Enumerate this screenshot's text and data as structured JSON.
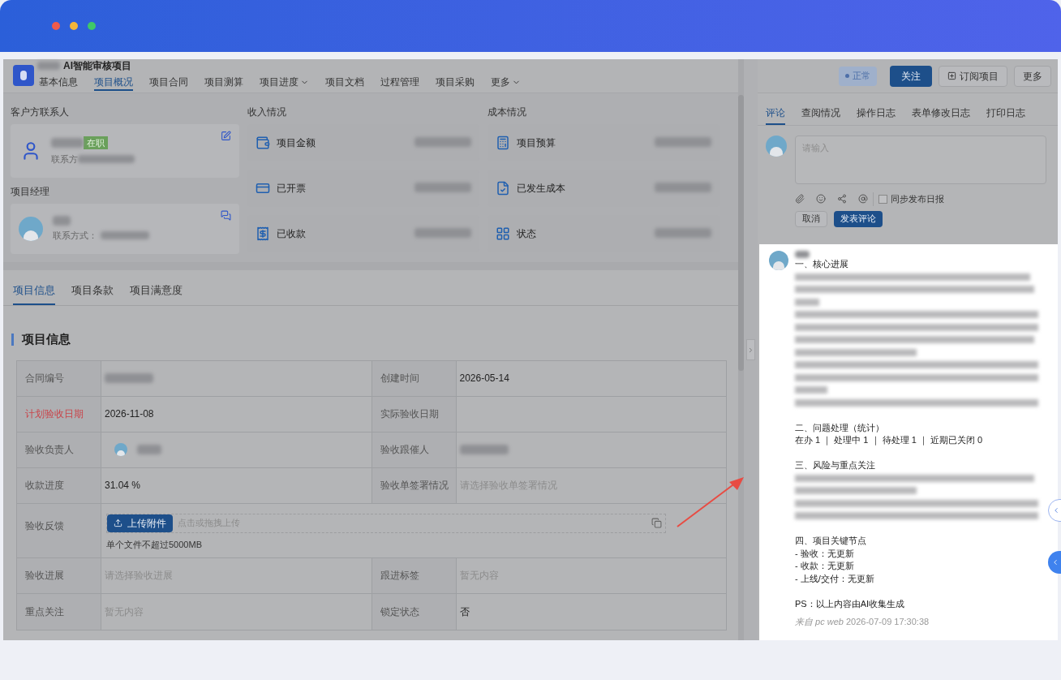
{
  "project": {
    "title": "AI智能审核项目",
    "status": "正常",
    "actions": [
      {
        "label": "关注",
        "kind": "primary"
      },
      {
        "label": "订阅项目",
        "kind": "subscribe"
      },
      {
        "label": "更多",
        "kind": "plain"
      }
    ]
  },
  "nav_tabs": [
    {
      "label": "基本信息",
      "selected": false,
      "dropdown": false
    },
    {
      "label": "项目概况",
      "selected": true,
      "dropdown": false
    },
    {
      "label": "项目合同",
      "selected": false,
      "dropdown": false
    },
    {
      "label": "项目测算",
      "selected": false,
      "dropdown": false
    },
    {
      "label": "项目进度",
      "selected": false,
      "dropdown": true
    },
    {
      "label": "项目文档",
      "selected": false,
      "dropdown": false
    },
    {
      "label": "过程管理",
      "selected": false,
      "dropdown": false
    },
    {
      "label": "项目采购",
      "selected": false,
      "dropdown": false
    },
    {
      "label": "更多",
      "selected": false,
      "dropdown": true
    }
  ],
  "customer_contact": {
    "heading": "客户方联系人",
    "badge": "在职",
    "contact_label": "联系方"
  },
  "project_manager": {
    "heading": "项目经理",
    "contact_label": "联系方式："
  },
  "income": {
    "heading": "收入情况",
    "items": [
      {
        "label": "项目金额",
        "kind": "wallet"
      },
      {
        "label": "已开票",
        "kind": "invoice"
      },
      {
        "label": "已收款",
        "kind": "received"
      }
    ]
  },
  "cost": {
    "heading": "成本情况",
    "items": [
      {
        "label": "项目预算",
        "kind": "budget"
      },
      {
        "label": "已发生成本",
        "kind": "spent"
      },
      {
        "label": "状态",
        "kind": "status"
      }
    ]
  },
  "detail_tabs": [
    {
      "label": "项目信息",
      "selected": true
    },
    {
      "label": "项目条款",
      "selected": false
    },
    {
      "label": "项目满意度",
      "selected": false
    }
  ],
  "section_title": "项目信息",
  "fields": [
    {
      "kind": "pair",
      "cells": [
        {
          "label": "合同编号",
          "required": false,
          "kind": "blurred"
        },
        {
          "label": "创建时间",
          "required": false,
          "kind": "text",
          "value": "2026-05-14"
        }
      ]
    },
    {
      "kind": "pair",
      "cells": [
        {
          "label": "计划验收日期",
          "required": true,
          "kind": "text",
          "value": "2026-11-08"
        },
        {
          "label": "实际验收日期",
          "required": false,
          "kind": "empty"
        }
      ]
    },
    {
      "kind": "pair",
      "cells": [
        {
          "label": "验收负责人",
          "required": false,
          "kind": "person"
        },
        {
          "label": "验收跟催人",
          "required": false,
          "kind": "blurred"
        }
      ]
    },
    {
      "kind": "pair",
      "cells": [
        {
          "label": "收款进度",
          "required": false,
          "kind": "text",
          "value": "31.04 %"
        },
        {
          "label": "验收单签署情况",
          "required": false,
          "kind": "placeholder",
          "placeholder": "请选择验收单签署情况"
        }
      ]
    },
    {
      "kind": "upload",
      "label": "验收反馈",
      "button": "上传附件",
      "hint": "点击或拖拽上传",
      "note": "单个文件不超过5000MB"
    },
    {
      "kind": "pair",
      "cells": [
        {
          "label": "验收进展",
          "required": false,
          "kind": "placeholder",
          "placeholder": "请选择验收进展"
        },
        {
          "label": "跟进标签",
          "required": false,
          "kind": "placeholder",
          "placeholder": "暂无内容"
        }
      ]
    },
    {
      "kind": "pair",
      "cells": [
        {
          "label": "重点关注",
          "required": false,
          "kind": "placeholder",
          "placeholder": "暂无内容"
        },
        {
          "label": "锁定状态",
          "required": false,
          "kind": "text",
          "value": "否"
        }
      ]
    }
  ],
  "comment_tabs": [
    {
      "label": "评论",
      "selected": true
    },
    {
      "label": "查阅情况",
      "selected": false
    },
    {
      "label": "操作日志",
      "selected": false
    },
    {
      "label": "表单修改日志",
      "selected": false
    },
    {
      "label": "打印日志",
      "selected": false
    }
  ],
  "comment_input": {
    "placeholder": "请输入"
  },
  "sync_daily": {
    "label": "同步发布日报",
    "checked": false
  },
  "comment_buttons": [
    {
      "label": "取消",
      "kind": "plain"
    },
    {
      "label": "发表评论",
      "kind": "primary"
    }
  ],
  "comment": {
    "lines": [
      {
        "kind": "heading",
        "text": "一、核心进展"
      },
      {
        "kind": "blurred"
      },
      {
        "kind": "blurred"
      },
      {
        "kind": "blurred"
      },
      {
        "kind": "blurred"
      },
      {
        "kind": "blurred"
      },
      {
        "kind": "blurred"
      },
      {
        "kind": "blurred"
      },
      {
        "kind": "blurred"
      },
      {
        "kind": "blurred"
      },
      {
        "kind": "blurred"
      },
      {
        "kind": "blurred"
      },
      {
        "kind": "spacer"
      },
      {
        "kind": "heading",
        "text": "二、问题处理（统计）"
      },
      {
        "kind": "text",
        "text": "在办 1 ｜ 处理中 1 ｜ 待处理 1 ｜ 近期已关闭 0"
      },
      {
        "kind": "spacer"
      },
      {
        "kind": "heading",
        "text": "三、风险与重点关注"
      },
      {
        "kind": "blurred"
      },
      {
        "kind": "blurred"
      },
      {
        "kind": "blurred"
      },
      {
        "kind": "blurred"
      },
      {
        "kind": "spacer"
      },
      {
        "kind": "heading",
        "text": "四、项目关键节点"
      },
      {
        "kind": "text",
        "text": "- 验收：无更新"
      },
      {
        "kind": "text",
        "text": "- 收款：无更新"
      },
      {
        "kind": "text",
        "text": "- 上线/交付：无更新"
      },
      {
        "kind": "spacer"
      },
      {
        "kind": "text",
        "text": "PS：以上内容由AI收集生成"
      }
    ],
    "source": "*来自 pc web* 2026-07-09 17:30:38"
  }
}
